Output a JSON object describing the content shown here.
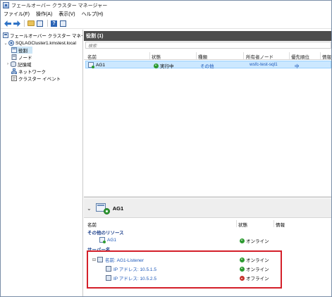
{
  "window": {
    "title": "フェールオーバー クラスター マネージャー"
  },
  "menu": [
    "ファイル(F)",
    "操作(A)",
    "表示(V)",
    "ヘルプ(H)"
  ],
  "tree": {
    "root": "フェールオーバー クラスター マネージャー",
    "cluster": "SQLAGCluster1.kmstest.local",
    "items": [
      "役割",
      "ノード",
      "記憶域",
      "ネットワーク",
      "クラスター イベント"
    ]
  },
  "roles_pane": {
    "header": "役割 (1)",
    "search_placeholder": "検索",
    "columns": [
      "名前",
      "状態",
      "種類",
      "所有者ノード",
      "優先順位",
      "情報"
    ],
    "rows": [
      {
        "name": "AG1",
        "status": "実行中",
        "type": "その他",
        "owner": "wsfc-test-sql1",
        "priority": "中",
        "info": ""
      }
    ]
  },
  "details": {
    "title": "AG1",
    "columns": [
      "名前",
      "状態",
      "情報"
    ],
    "group_other": "その他のリソース",
    "other_resource": {
      "name": "AG1",
      "status": "オンライン"
    },
    "group_server": "サーバー名",
    "listener": {
      "name": "名前: AG1-Listener",
      "status": "オンライン"
    },
    "ips": [
      {
        "name": "IP アドレス: 10.5.1.5",
        "status": "オンライン",
        "state": "up"
      },
      {
        "name": "IP アドレス: 10.5.2.5",
        "status": "オフライン",
        "state": "down"
      }
    ]
  },
  "colors": {
    "header_bg": "#4d4d4d",
    "selection": "#cce8ff",
    "online": "#2e9b32",
    "offline": "#c6342e",
    "highlight_box": "#d4202a"
  }
}
